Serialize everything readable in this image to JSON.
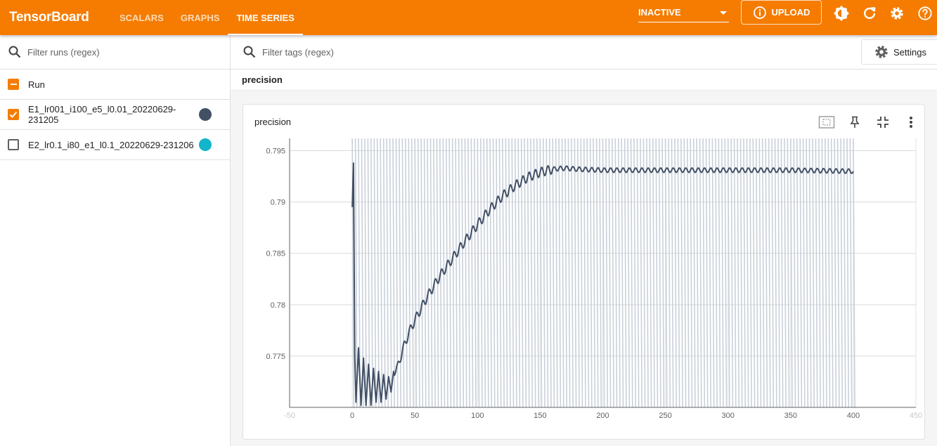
{
  "header": {
    "app_name": "TensorBoard",
    "tabs": [
      {
        "label": "SCALARS"
      },
      {
        "label": "GRAPHS"
      },
      {
        "label": "TIME SERIES"
      }
    ],
    "active_tab": "TIME SERIES",
    "run_selector_value": "INACTIVE",
    "upload_label": "UPLOAD",
    "icons": [
      "upload-info-icon",
      "theme-toggle-icon",
      "refresh-icon",
      "gear-icon",
      "help-icon"
    ]
  },
  "sidebar": {
    "filter_placeholder": "Filter runs (regex)",
    "header_label": "Run",
    "runs": [
      {
        "name": "E1_lr001_i100_e5_l0.01_20220629-231205",
        "checked": true,
        "color": "#425066"
      },
      {
        "name": "E2_lr0.1_i80_e1_l0.1_20220629-231206",
        "checked": false,
        "color": "#12b5cb"
      }
    ]
  },
  "main": {
    "tag_filter_placeholder": "Filter tags (regex)",
    "settings_label": "Settings",
    "group_title": "precision",
    "card": {
      "title": "precision",
      "tools": [
        "fit-domain-icon",
        "pin-icon",
        "collapse-icon",
        "more-vert-icon"
      ]
    }
  },
  "colors": {
    "accent": "#f57c00",
    "series_main": "#425066",
    "series_background": "#c6cdd8"
  },
  "chart_data": {
    "type": "line",
    "title": "precision",
    "xlabel": "",
    "ylabel": "",
    "xlim": [
      -50,
      450
    ],
    "ylim": [
      0.77,
      0.7962
    ],
    "x_ticks": [
      -50,
      0,
      50,
      100,
      150,
      200,
      250,
      300,
      350,
      400,
      450
    ],
    "y_ticks": [
      0.775,
      0.78,
      0.785,
      0.79,
      0.795
    ],
    "grid": true,
    "series": [
      {
        "name": "E1_lr001_i100_e5_l0.01_20220629-231205",
        "role": "smoothed",
        "color": "#425066",
        "points": [
          [
            0,
            0.7895
          ],
          [
            1,
            0.7938
          ],
          [
            2,
            0.775
          ],
          [
            3,
            0.7705
          ],
          [
            5,
            0.7758
          ],
          [
            7,
            0.7702
          ],
          [
            9,
            0.7748
          ],
          [
            11,
            0.7702
          ],
          [
            13,
            0.7742
          ],
          [
            15,
            0.7702
          ],
          [
            17,
            0.7738
          ],
          [
            19,
            0.7705
          ],
          [
            21,
            0.7735
          ],
          [
            23,
            0.7705
          ],
          [
            25,
            0.7732
          ],
          [
            27,
            0.7708
          ],
          [
            29,
            0.773
          ],
          [
            31,
            0.7715
          ],
          [
            33,
            0.7735
          ],
          [
            36,
            0.7738
          ],
          [
            40,
            0.7755
          ],
          [
            45,
            0.7772
          ],
          [
            50,
            0.7785
          ],
          [
            60,
            0.7808
          ],
          [
            70,
            0.7828
          ],
          [
            80,
            0.7845
          ],
          [
            90,
            0.7862
          ],
          [
            100,
            0.7878
          ],
          [
            110,
            0.7893
          ],
          [
            120,
            0.7906
          ],
          [
            130,
            0.7916
          ],
          [
            140,
            0.7924
          ],
          [
            150,
            0.7929
          ],
          [
            160,
            0.7932
          ],
          [
            170,
            0.7933
          ],
          [
            180,
            0.7932
          ],
          [
            200,
            0.7931
          ],
          [
            250,
            0.7931
          ],
          [
            300,
            0.7931
          ],
          [
            350,
            0.7931
          ],
          [
            400,
            0.793
          ]
        ]
      },
      {
        "name": "E1_lr001_i100_e5_l0.01_20220629-231205",
        "role": "raw",
        "color": "#c6cdd8",
        "description": "raw values oscillating between the axis bottom and top on every step from 0 to 400"
      }
    ]
  }
}
